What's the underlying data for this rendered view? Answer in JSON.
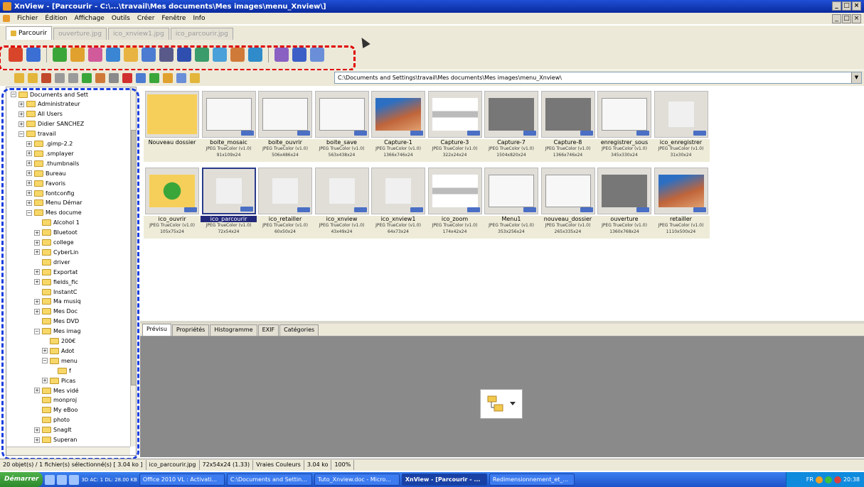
{
  "window": {
    "title": "XnView - [Parcourir - C:\\...\\travail\\Mes documents\\Mes images\\menu_Xnview\\]",
    "min": "_",
    "max": "□",
    "close": "×"
  },
  "menu": {
    "items": [
      "Fichier",
      "Édition",
      "Affichage",
      "Outils",
      "Créer",
      "Fenêtre",
      "Info"
    ]
  },
  "tabs": [
    "Parcourir",
    "ouverture.jpg",
    "ico_xnview1.jpg",
    "ico_parcourir.jpg"
  ],
  "toolbar1": {
    "colors": [
      "#d9452b",
      "#3b6fd4",
      "#3aa63a",
      "#e0a12e",
      "#d05a9a",
      "#3b86d4",
      "#e8b342",
      "#4b7cd1",
      "#5a5a8a",
      "#2f4fb0",
      "#3b9c6b",
      "#4aa0d8",
      "#d07a3a",
      "#2f8bc9",
      "#8a60c2",
      "#3c5fc7",
      "#6a8fd8"
    ]
  },
  "toolbar2": {
    "address": "C:\\Documents and Settings\\travail\\Mes documents\\Mes images\\menu_Xnview\\",
    "address_dropdown": "▼"
  },
  "tree": {
    "items": [
      {
        "label": "Documents and Sett",
        "indent": 0,
        "exp": "−"
      },
      {
        "label": "Administrateur",
        "indent": 1,
        "exp": "+"
      },
      {
        "label": "All Users",
        "indent": 1,
        "exp": "+"
      },
      {
        "label": "Didier SANCHEZ",
        "indent": 1,
        "exp": "+"
      },
      {
        "label": "travail",
        "indent": 1,
        "exp": "−"
      },
      {
        "label": ".gimp-2.2",
        "indent": 2,
        "exp": "+"
      },
      {
        "label": ".smplayer",
        "indent": 2,
        "exp": "+"
      },
      {
        "label": ".thumbnails",
        "indent": 2,
        "exp": "+"
      },
      {
        "label": "Bureau",
        "indent": 2,
        "exp": "+"
      },
      {
        "label": "Favoris",
        "indent": 2,
        "exp": "+"
      },
      {
        "label": "fontconfig",
        "indent": 2,
        "exp": "+"
      },
      {
        "label": "Menu Démar",
        "indent": 2,
        "exp": "+"
      },
      {
        "label": "Mes docume",
        "indent": 2,
        "exp": "−"
      },
      {
        "label": "Alcohol 1",
        "indent": 3,
        "exp": ""
      },
      {
        "label": "Bluetoot",
        "indent": 3,
        "exp": "+"
      },
      {
        "label": "college",
        "indent": 3,
        "exp": "+"
      },
      {
        "label": "CyberLin",
        "indent": 3,
        "exp": "+"
      },
      {
        "label": "driver",
        "indent": 3,
        "exp": ""
      },
      {
        "label": "Exportat",
        "indent": 3,
        "exp": "+"
      },
      {
        "label": "fields_fic",
        "indent": 3,
        "exp": "+"
      },
      {
        "label": "InstantC",
        "indent": 3,
        "exp": ""
      },
      {
        "label": "Ma musiq",
        "indent": 3,
        "exp": "+"
      },
      {
        "label": "Mes Doc",
        "indent": 3,
        "exp": "+"
      },
      {
        "label": "Mes DVD",
        "indent": 3,
        "exp": ""
      },
      {
        "label": "Mes imag",
        "indent": 3,
        "exp": "−"
      },
      {
        "label": "200€",
        "indent": 4,
        "exp": ""
      },
      {
        "label": "Adot",
        "indent": 4,
        "exp": "+"
      },
      {
        "label": "menu",
        "indent": 4,
        "exp": "−"
      },
      {
        "label": "f",
        "indent": 5,
        "exp": ""
      },
      {
        "label": "Picas",
        "indent": 4,
        "exp": "+"
      },
      {
        "label": "Mes vidé",
        "indent": 3,
        "exp": "+"
      },
      {
        "label": "monproj",
        "indent": 3,
        "exp": ""
      },
      {
        "label": "My eBoo",
        "indent": 3,
        "exp": ""
      },
      {
        "label": "photo",
        "indent": 3,
        "exp": ""
      },
      {
        "label": "SnagIt",
        "indent": 3,
        "exp": "+"
      },
      {
        "label": "Superan",
        "indent": 3,
        "exp": "+"
      }
    ]
  },
  "thumbnails": [
    {
      "name": "Nouveau dossier",
      "l2": "",
      "l3": "",
      "kind": "folder"
    },
    {
      "name": "boite_mosaic",
      "l2": "JPEG TrueColor (v1.0)",
      "l3": "91x109x24",
      "kind": "dialog"
    },
    {
      "name": "boite_ouvrir",
      "l2": "JPEG TrueColor (v1.0)",
      "l3": "506x486x24",
      "kind": "dialog"
    },
    {
      "name": "boite_save",
      "l2": "JPEG TrueColor (v1.0)",
      "l3": "563x438x24",
      "kind": "dialog"
    },
    {
      "name": "Capture-1",
      "l2": "JPEG TrueColor (v1.0)",
      "l3": "1366x746x24",
      "kind": "photo"
    },
    {
      "name": "Capture-3",
      "l2": "JPEG TrueColor (v1.0)",
      "l3": "322x24x24",
      "kind": "bar"
    },
    {
      "name": "Capture-7",
      "l2": "JPEG TrueColor (v1.0)",
      "l3": "1504x820x24",
      "kind": "screen"
    },
    {
      "name": "Capture-8",
      "l2": "JPEG TrueColor (v1.0)",
      "l3": "1366x746x24",
      "kind": "screen"
    },
    {
      "name": "enregistrer_sous",
      "l2": "JPEG TrueColor (v1.0)",
      "l3": "345x330x24",
      "kind": "dialog"
    },
    {
      "name": "ico_enregistrer",
      "l2": "JPEG TrueColor (v1.0)",
      "l3": "31x30x24",
      "kind": "icon"
    },
    {
      "name": "ico_ouvrir",
      "l2": "JPEG TrueColor (v1.0)",
      "l3": "105x75x24",
      "kind": "folder-arrow"
    },
    {
      "name": "ico_parcourir",
      "l2": "JPEG TrueColor (v1.0)",
      "l3": "72x54x24",
      "kind": "icon"
    },
    {
      "name": "ico_retailler",
      "l2": "JPEG TrueColor (v1.0)",
      "l3": "60x50x24",
      "kind": "icon"
    },
    {
      "name": "ico_xnview",
      "l2": "JPEG TrueColor (v1.0)",
      "l3": "43x49x24",
      "kind": "icon"
    },
    {
      "name": "ico_xnview1",
      "l2": "JPEG TrueColor (v1.0)",
      "l3": "64x73x24",
      "kind": "icon"
    },
    {
      "name": "ico_zoom",
      "l2": "JPEG TrueColor (v1.0)",
      "l3": "174x42x24",
      "kind": "bar"
    },
    {
      "name": "Menu1",
      "l2": "JPEG TrueColor (v1.0)",
      "l3": "353x256x24",
      "kind": "dialog"
    },
    {
      "name": "nouveau_dossier",
      "l2": "JPEG TrueColor (v1.0)",
      "l3": "265x335x24",
      "kind": "dialog"
    },
    {
      "name": "ouverture",
      "l2": "JPEG TrueColor (v1.0)",
      "l3": "1360x768x24",
      "kind": "screen"
    },
    {
      "name": "retailler",
      "l2": "JPEG TrueColor (v1.0)",
      "l3": "1110x500x24",
      "kind": "photo"
    }
  ],
  "preview_tabs": [
    "Prévisu",
    "Propriétés",
    "Histogramme",
    "EXIF",
    "Catégories"
  ],
  "status": {
    "count": "20 objet(s) / 1 fichier(s) sélectionné(s)  [ 3.04 ko ]",
    "file": "ico_parcourir.jpg",
    "dims": "72x54x24 (1.33)",
    "colors": "Vraies Couleurs",
    "size": "3.04 ko",
    "zoom": "100%"
  },
  "taskbar": {
    "start": "Démarrer",
    "info": "3D AC: 1 DL: 28.00 KB",
    "tasks": [
      "Office 2010 VL : Activati...",
      "C:\\Documents and Settin...",
      "Tuto_Xnview.doc - Micro...",
      "XnView - [Parcourir - ...",
      "Redimensionnement_et_..."
    ],
    "clock": "20:38",
    "lang": "FR"
  }
}
